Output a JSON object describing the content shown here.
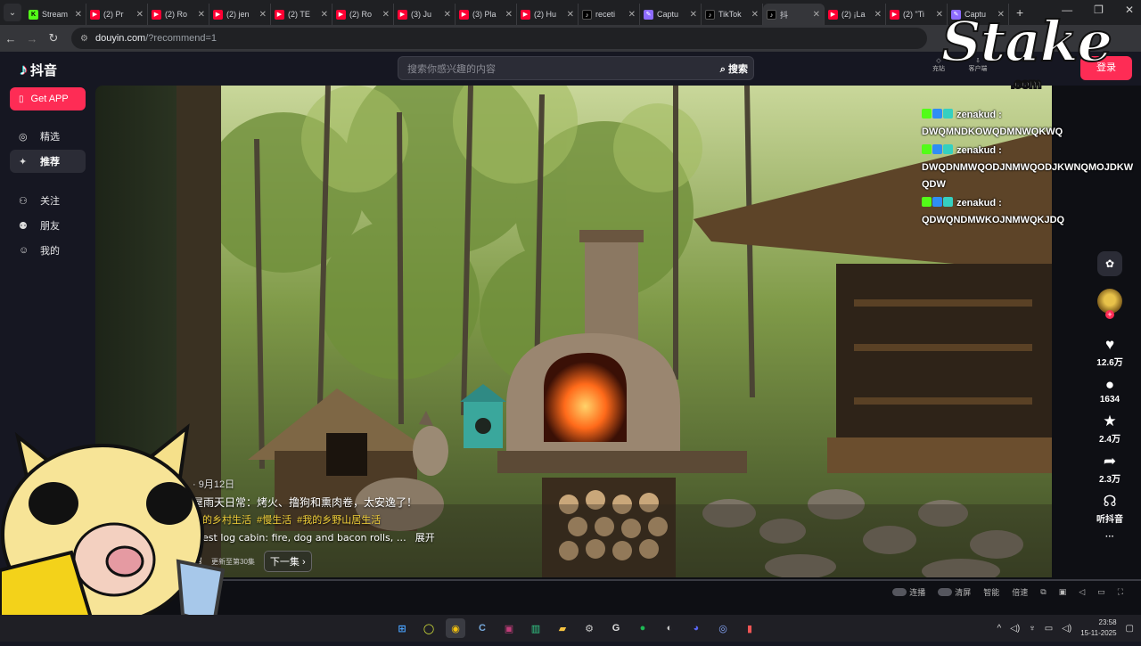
{
  "browser": {
    "tabs": [
      {
        "label": "Stream",
        "icon": "kick"
      },
      {
        "label": "(2) Pr",
        "icon": "youtube"
      },
      {
        "label": "(2) Ro",
        "icon": "youtube"
      },
      {
        "label": "(2) jen",
        "icon": "youtube"
      },
      {
        "label": "(2) TE",
        "icon": "youtube"
      },
      {
        "label": "(2) Ro",
        "icon": "youtube"
      },
      {
        "label": "(3) Ju",
        "icon": "youtube"
      },
      {
        "label": "(3) Pla",
        "icon": "youtube"
      },
      {
        "label": "(2) Hu",
        "icon": "youtube"
      },
      {
        "label": "receti",
        "icon": "tiktok"
      },
      {
        "label": "Captu",
        "icon": "capcut"
      },
      {
        "label": "TikTok",
        "icon": "tiktok"
      },
      {
        "label": "抖",
        "icon": "tiktok",
        "active": true
      },
      {
        "label": "(2) ¡La",
        "icon": "youtube"
      },
      {
        "label": "(2) \"Ti",
        "icon": "youtube"
      },
      {
        "label": "Captu",
        "icon": "capcut"
      }
    ],
    "url_domain": "douyin.com",
    "url_path": "/?recommend=1"
  },
  "douyin": {
    "logo_text": "抖音",
    "search_placeholder": "搜索你感兴趣的内容",
    "search_button": "搜索",
    "top_icons": [
      "充钻",
      "客户端"
    ],
    "login_button": "登录",
    "get_app": "Get APP",
    "nav": [
      {
        "label": "精选",
        "icon": "compass-icon"
      },
      {
        "label": "推荐",
        "icon": "sparkle-icon",
        "selected": true
      },
      {
        "label": "关注",
        "icon": "follow-icon"
      },
      {
        "label": "朋友",
        "icon": "friends-icon"
      },
      {
        "label": "我的",
        "icon": "user-icon"
      }
    ]
  },
  "video": {
    "date": "· 9月12日",
    "title": "屋雨天日常：烤火、撸狗和熏肉卷，太安逸了！",
    "tags": [
      "我的乡村生活",
      "#慢生活",
      "#我的乡野山居生活"
    ],
    "english": "orest log cabin: fire, dog and bacon rolls, …",
    "expand": "展开",
    "series_name": "屋",
    "series_count": "更新至第30集",
    "next_episode": "下一集",
    "stats": {
      "likes": "12.6万",
      "comments": "1634",
      "favorites": "2.4万",
      "shares": "2.3万",
      "listen": "听抖音",
      "more": "···"
    }
  },
  "player_controls": {
    "items": [
      "连播",
      "清屏",
      "智能",
      "倍速"
    ]
  },
  "chat": [
    {
      "user": "zenakud",
      "text": "DWQMNDKOWQDMNWQKWQ"
    },
    {
      "user": "zenakud",
      "text": "DWQDNMWQODJNMWQODJKWNQMOJDKWQDW"
    },
    {
      "user": "zenakud",
      "text": "QDWQNDMWKOJNMWQKJDQ"
    }
  ],
  "overlay": {
    "brand": "Stake",
    "brand_suffix": ".com"
  },
  "taskbar": {
    "time": "23:58",
    "date": "15-11-2025"
  },
  "colors": {
    "accent": "#fe2c55",
    "tag_yellow": "#f4d23a",
    "kick_green": "#53fc18"
  }
}
